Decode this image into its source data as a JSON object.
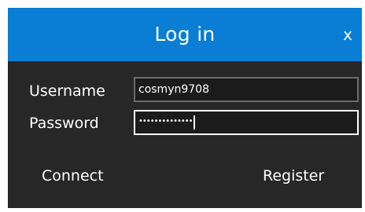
{
  "dialog": {
    "title": "Log in",
    "close_label": "x"
  },
  "form": {
    "username_label": "Username",
    "username_value": "cosmyn9708",
    "password_label": "Password",
    "password_mask": "••••••••••••••"
  },
  "actions": {
    "connect_label": "Connect",
    "register_label": "Register"
  },
  "colors": {
    "titlebar": "#0a7ed4",
    "background": "#272727",
    "field_background": "#1b1b1b"
  }
}
